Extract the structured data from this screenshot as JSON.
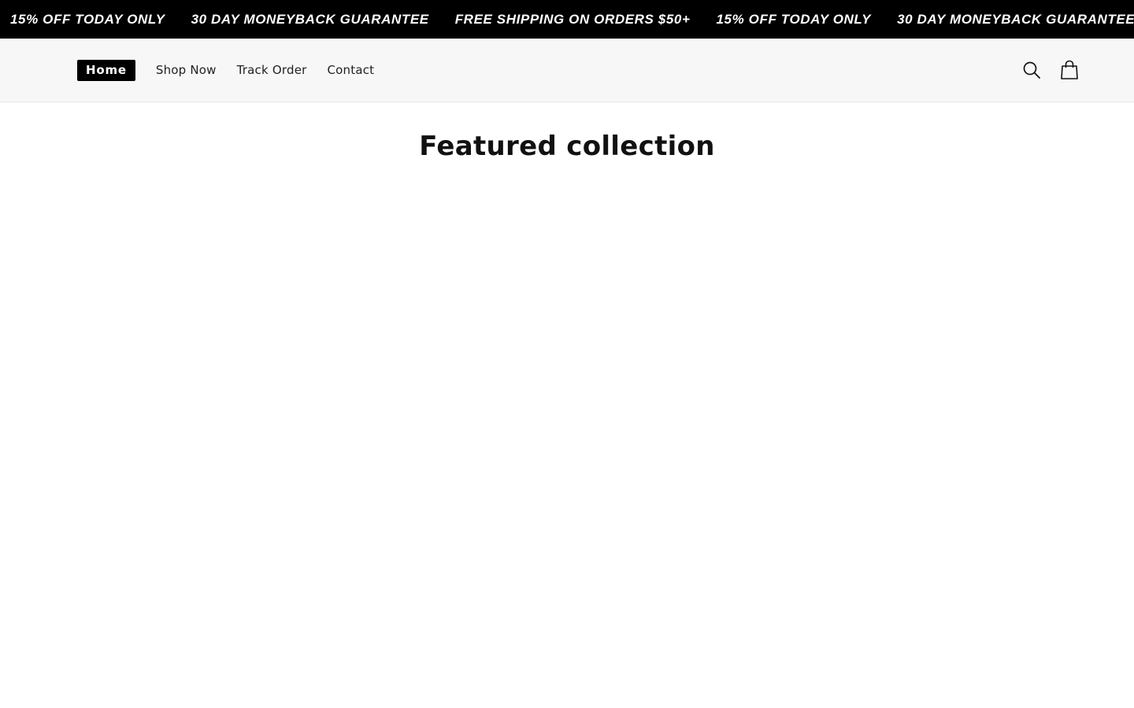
{
  "announcement": {
    "items": [
      "15% OFF TODAY ONLY",
      "30 DAY MONEYBACK GUARANTEE",
      "FREE SHIPPING ON ORDERS $50+",
      "15% OFF TODAY ONLY",
      "30 DAY MONEYBACK GUARANTEE"
    ]
  },
  "header": {
    "nav": {
      "home": "Home",
      "shop_now": "Shop Now",
      "track_order": "Track Order",
      "contact": "Contact"
    },
    "icons": {
      "search": "search-icon",
      "cart": "shopping-bag-icon"
    }
  },
  "main": {
    "section_title": "Featured collection"
  },
  "colors": {
    "announcement_bg": "#000000",
    "header_bg": "#f7f7f7",
    "active_nav_bg": "#000000",
    "text": "#121212"
  }
}
